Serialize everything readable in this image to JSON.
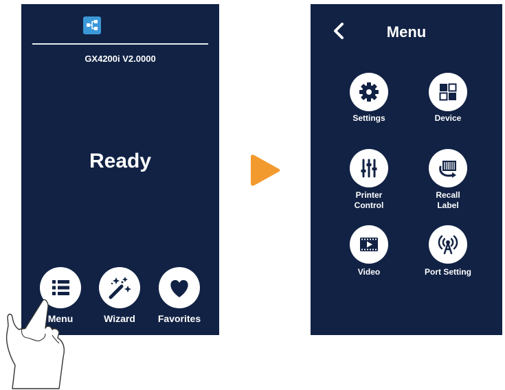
{
  "home": {
    "firmware": "GX4200i V2.0000",
    "status": "Ready",
    "buttons": [
      {
        "label": "Menu",
        "icon": "list-icon"
      },
      {
        "label": "Wizard",
        "icon": "magic-wand-icon"
      },
      {
        "label": "Favorites",
        "icon": "heart-icon"
      }
    ]
  },
  "menu": {
    "title": "Menu",
    "items": [
      {
        "lines": [
          "Settings"
        ],
        "icon": "gear-icon"
      },
      {
        "lines": [
          "Device"
        ],
        "icon": "device-grid-icon"
      },
      {
        "lines": [
          "Printer",
          "Control"
        ],
        "icon": "sliders-icon"
      },
      {
        "lines": [
          "Recall",
          "Label"
        ],
        "icon": "recall-label-icon"
      },
      {
        "lines": [
          "Video"
        ],
        "icon": "video-icon"
      },
      {
        "lines": [
          "Port Setting"
        ],
        "icon": "antenna-icon"
      }
    ]
  },
  "colors": {
    "screen_background": "#112244",
    "arrow": "#f39a2e",
    "network_icon": "#3b98d8",
    "icon_fill": "#112244"
  }
}
